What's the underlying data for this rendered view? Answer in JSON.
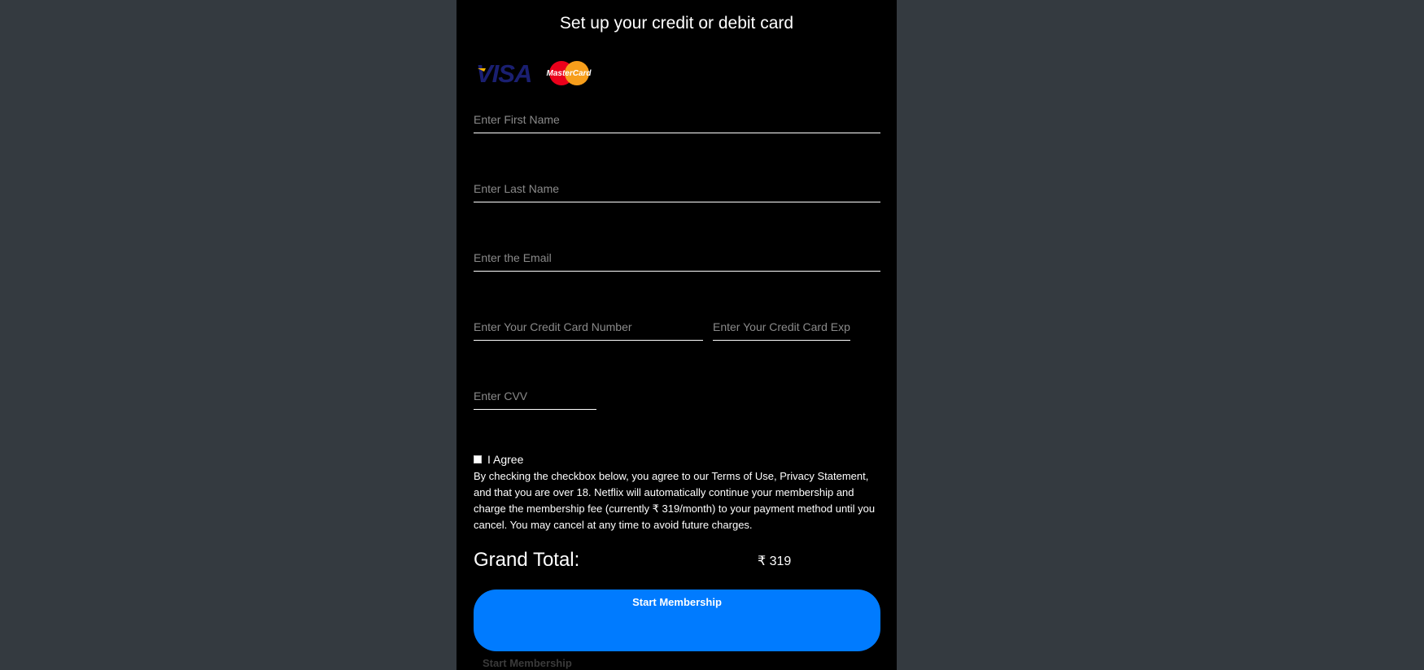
{
  "page": {
    "title": "Set up your credit or debit card"
  },
  "card_logos": {
    "visa_text": "VISA",
    "mastercard_text": "MasterCard",
    "colors": {
      "visa_blue": "#1a1f71",
      "visa_gold": "#f7b600",
      "mc_red": "#eb001b",
      "mc_orange": "#f79e1b"
    }
  },
  "form": {
    "first_name": {
      "placeholder": "Enter First Name",
      "value": ""
    },
    "last_name": {
      "placeholder": "Enter Last Name",
      "value": ""
    },
    "email": {
      "placeholder": "Enter the Email",
      "value": ""
    },
    "card_number": {
      "placeholder": "Enter Your Credit Card Number",
      "value": ""
    },
    "card_expiry": {
      "placeholder": "Enter Your Credit Card Expiry",
      "value": ""
    },
    "cvv": {
      "placeholder": "Enter CVV",
      "value": ""
    }
  },
  "agreement": {
    "checkbox_label": "I Agree",
    "terms_text": "By checking the checkbox below, you agree to our Terms of Use, Privacy Statement, and that you are over 18. Netflix will automatically continue your membership and charge the membership fee (currently ₹ 319/month) to your payment method until you cancel. You may cancel at any time to avoid future charges."
  },
  "total": {
    "label": "Grand Total:",
    "value": "₹ 319"
  },
  "actions": {
    "start_membership_label": "Start Membership",
    "ghost_label": "Start Membership"
  },
  "colors": {
    "background": "#343a40",
    "panel": "#000000",
    "accent": "#007bff"
  }
}
